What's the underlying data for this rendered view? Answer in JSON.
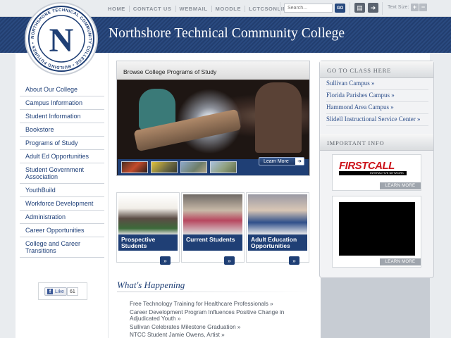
{
  "topnav": [
    "HOME",
    "CONTACT US",
    "WEBMAIL",
    "MOODLE",
    "LCTCSONLINE"
  ],
  "search": {
    "placeholder": "Search...",
    "go_label": "GO"
  },
  "toolbar": {
    "text_size_label": "Text Size:",
    "increase": "+",
    "decrease": "−"
  },
  "header": {
    "title": "Northshore Technical Community College"
  },
  "seal": {
    "initial": "N",
    "ring_text": "NORTHSHORE TECHNICAL COMMUNITY COLLEGE • BUILDING FUTURES •"
  },
  "leftnav": [
    "About Our College",
    "Campus Information",
    "Student Information",
    "Bookstore",
    "Programs of Study",
    "Adult Ed Opportunities",
    "Student Government Association",
    "YouthBuild",
    "Workforce Development",
    "Administration",
    "Career Opportunities",
    "College and Career Transitions"
  ],
  "facebook": {
    "like_label": "Like",
    "count": "61"
  },
  "feature": {
    "caption": "Browse College Programs of Study",
    "learn_more": "Learn More"
  },
  "audiences": [
    {
      "label": "Prospective Students"
    },
    {
      "label": "Current Students"
    },
    {
      "label": "Adult Education Opportunities"
    }
  ],
  "whats_happening": {
    "title": "What's Happening",
    "items": [
      "Free Technology Training for Healthcare Professionals »",
      "Career Development Program Influences Positive Change in Adjudicated Youth »",
      "Sullivan Celebrates Milestone Graduation »",
      "NTCC Student Jamie Owens, Artist »"
    ]
  },
  "go_to_class": {
    "heading": "GO TO CLASS HERE",
    "campuses": [
      "Sullivan Campus »",
      "Florida Parishes Campus »",
      "Hammond Area Campus »",
      "Slidell Instructional Service Center »"
    ]
  },
  "important_info": {
    "heading": "IMPORTANT INFO",
    "firstcall_logo": "FIRSTCALL",
    "firstcall_sub": "INTERACTIVE NETWORK",
    "learn_more_1": "LEARN MORE",
    "learn_more_2": "LEARN MORE"
  },
  "colors": {
    "brand_navy": "#223e6f",
    "link": "#1e3f78",
    "accent_red": "#cc1219"
  }
}
